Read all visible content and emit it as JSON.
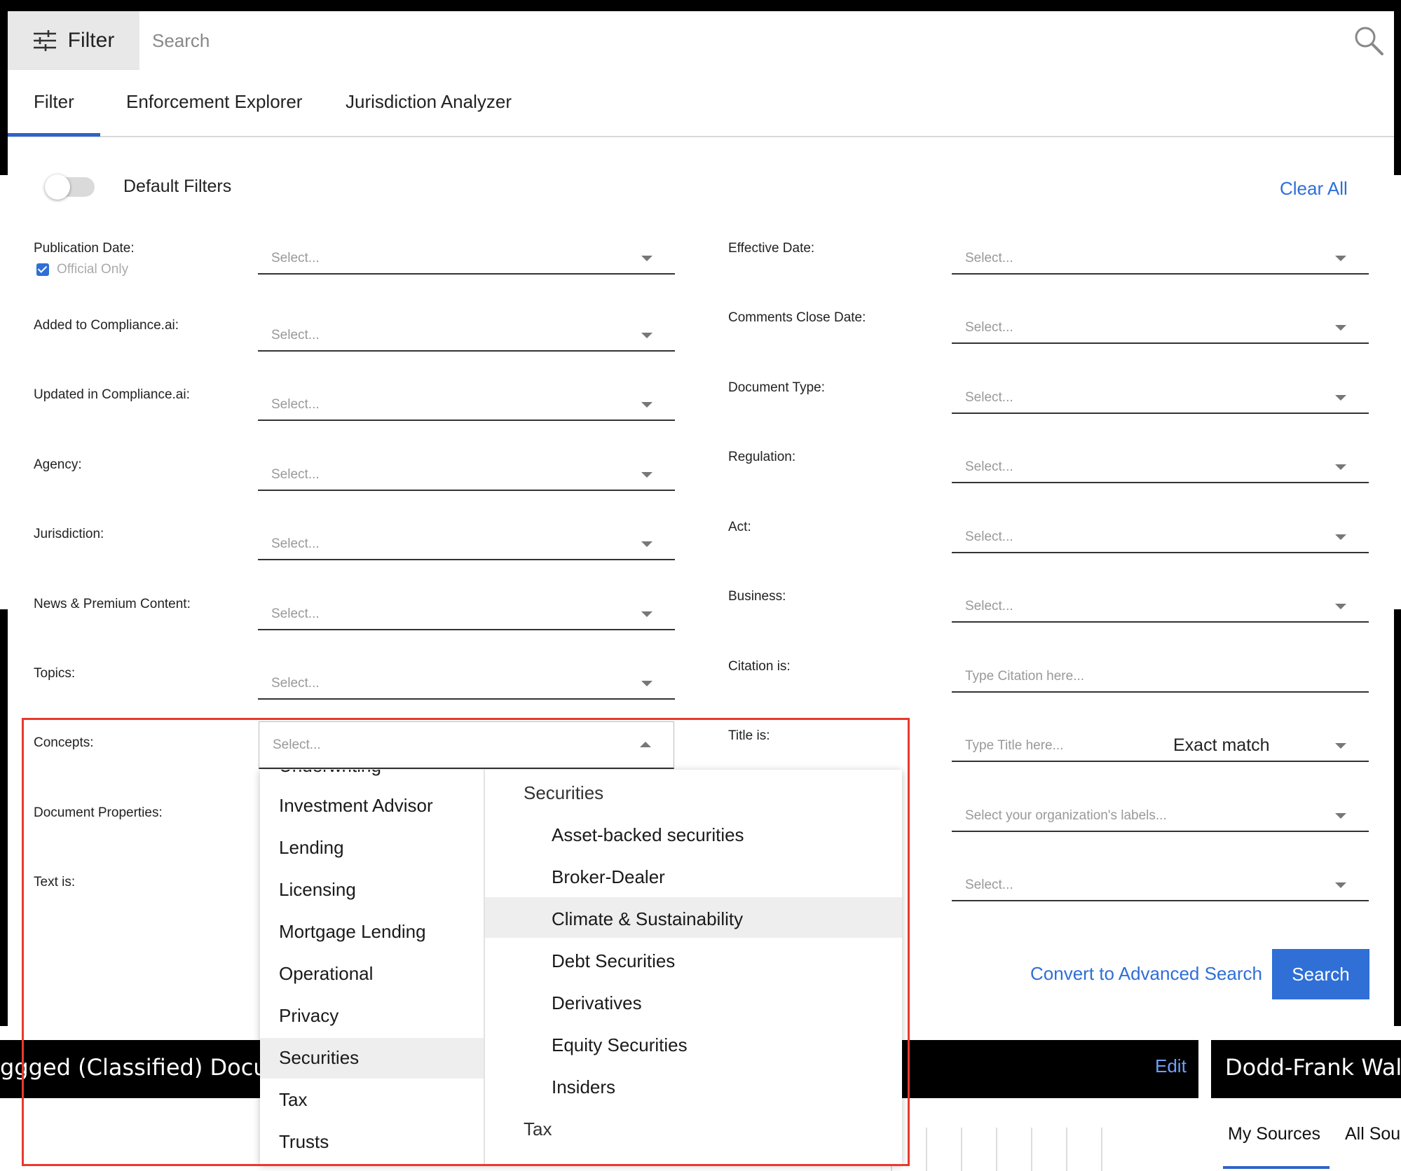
{
  "search_bar": {
    "filter_label": "Filter",
    "placeholder": "Search"
  },
  "tabs": [
    {
      "label": "Filter",
      "active": true
    },
    {
      "label": "Enforcement Explorer"
    },
    {
      "label": "Jurisdiction Analyzer"
    }
  ],
  "default_filters": {
    "label": "Default Filters",
    "enabled": false
  },
  "clear_all": "Clear All",
  "select_placeholder": "Select...",
  "official_only": {
    "label": "Official Only",
    "checked": true
  },
  "left_fields": [
    "Publication Date:",
    "Added to Compliance.ai:",
    "Updated in Compliance.ai:",
    "Agency:",
    "Jurisdiction:",
    "News & Premium Content:",
    "Topics:",
    "Concepts:",
    "Document Properties:",
    "Text is:"
  ],
  "right_fields": [
    "Effective Date:",
    "Comments Close Date:",
    "Document Type:",
    "Regulation:",
    "Act:",
    "Business:",
    "Citation is:",
    "Title is:"
  ],
  "citation_placeholder": "Type Citation here...",
  "title_placeholder": "Type Title here...",
  "title_match": "Exact match",
  "labels_placeholder": "Select your organization's labels...",
  "convert_link": "Convert to Advanced Search",
  "search_button": "Search",
  "concepts_dropdown": {
    "categories": [
      "Underwriting",
      "Investment Advisor",
      "Lending",
      "Licensing",
      "Mortgage Lending",
      "Operational",
      "Privacy",
      "Securities",
      "Tax",
      "Trusts"
    ],
    "selected_category": "Securities",
    "group_heading": "Securities",
    "sub_items": [
      "Asset-backed securities",
      "Broker-Dealer",
      "Climate & Sustainability",
      "Debt Securities",
      "Derivatives",
      "Equity Securities",
      "Insiders"
    ],
    "hovered_item": "Climate & Sustainability",
    "next_group": "Tax"
  },
  "background": {
    "card1_title": "ggged (Classified) Docu",
    "card1_action": "Edit",
    "card2_title": "Dodd-Frank Wal",
    "card2_tabs": [
      "My Sources",
      "All Sou"
    ]
  }
}
